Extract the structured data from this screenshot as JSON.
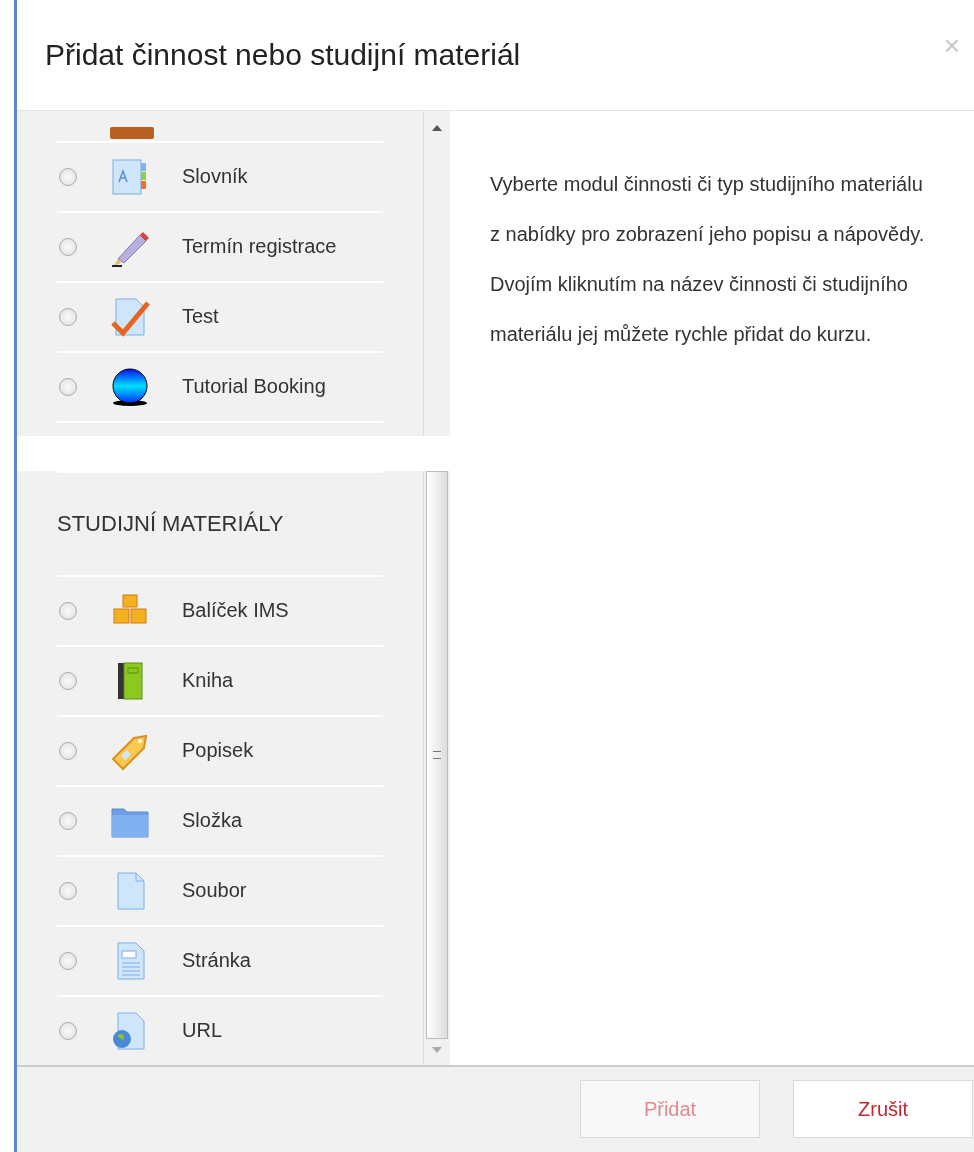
{
  "dialog": {
    "title": "Přidat činnost nebo studijní materiál",
    "close": "×"
  },
  "activities": [
    {
      "label": "Slovník",
      "kind": "glossary",
      "selected": false
    },
    {
      "label": "Termín registrace",
      "kind": "pencil",
      "selected": false
    },
    {
      "label": "Test",
      "kind": "quiz",
      "selected": false
    },
    {
      "label": "Tutorial Booking",
      "kind": "sphere",
      "selected": false
    }
  ],
  "resources_heading": "STUDIJNÍ MATERIÁLY",
  "resources": [
    {
      "label": "Balíček IMS",
      "kind": "boxes",
      "selected": false
    },
    {
      "label": "Kniha",
      "kind": "book",
      "selected": false
    },
    {
      "label": "Popisek",
      "kind": "tag",
      "selected": false
    },
    {
      "label": "Složka",
      "kind": "folder",
      "selected": false
    },
    {
      "label": "Soubor",
      "kind": "file",
      "selected": false
    },
    {
      "label": "Stránka",
      "kind": "page",
      "selected": false
    },
    {
      "label": "URL",
      "kind": "url",
      "selected": false
    }
  ],
  "description": "Vyberte modul činnosti či typ studijního materiálu z nabídky pro zobrazení jeho popisu a nápovědy. Dvojím kliknutím na název činnosti či studijního materiálu jej můžete rychle přidat do kurzu.",
  "buttons": [
    {
      "label": "Přidat",
      "disabled": true
    },
    {
      "label": "Zrušit",
      "disabled": false
    }
  ]
}
